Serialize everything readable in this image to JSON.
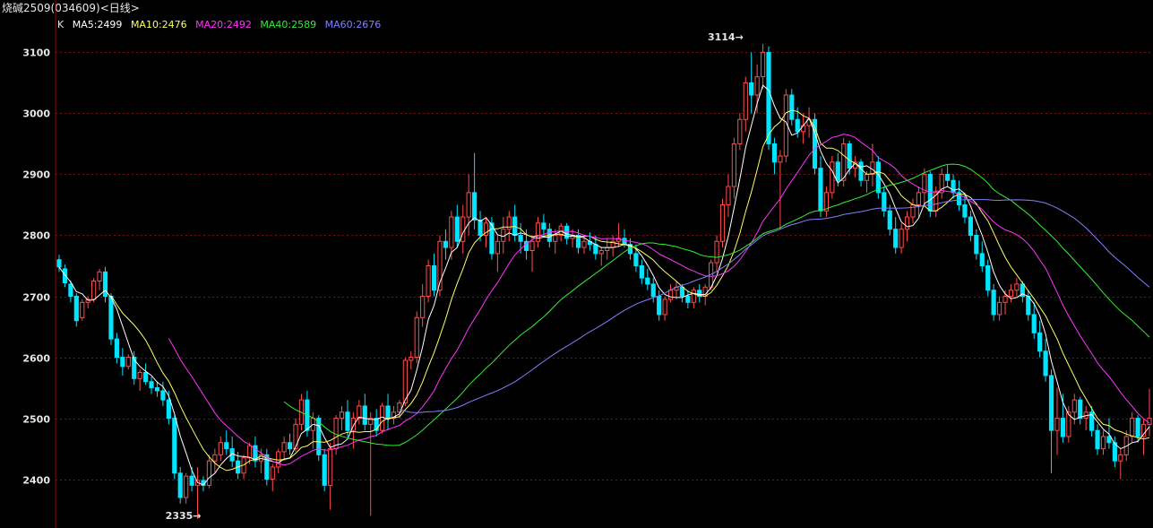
{
  "title": {
    "instrument": "烧碱2509",
    "code": "(034609)",
    "period": "<日线>"
  },
  "legend": {
    "k_label": "K",
    "items": [
      {
        "label": "MA5:2499",
        "color": "#ffffff"
      },
      {
        "label": "MA10:2476",
        "color": "#ffff66"
      },
      {
        "label": "MA20:2492",
        "color": "#ff33ff"
      },
      {
        "label": "MA40:2589",
        "color": "#33ee33"
      },
      {
        "label": "MA60:2676",
        "color": "#8080ff"
      }
    ]
  },
  "colors": {
    "up": "#ff4d4d",
    "down": "#00e5ff",
    "grid": "#7a1010",
    "axis": "#a00000"
  },
  "chart_data": {
    "type": "candlestick",
    "ylim": [
      2320,
      3130
    ],
    "yticks": [
      2400,
      2500,
      2600,
      2700,
      2800,
      2900,
      3000,
      3100
    ],
    "annotations": [
      {
        "text": "3114→",
        "index": 118,
        "value": 3114
      },
      {
        "text": "2335→",
        "index": 24,
        "value": 2335
      }
    ],
    "ohlc": [
      [
        2760,
        2768,
        2740,
        2748
      ],
      [
        2745,
        2752,
        2715,
        2722
      ],
      [
        2720,
        2726,
        2690,
        2700
      ],
      [
        2700,
        2705,
        2650,
        2660
      ],
      [
        2665,
        2695,
        2660,
        2690
      ],
      [
        2690,
        2700,
        2680,
        2695
      ],
      [
        2695,
        2730,
        2690,
        2725
      ],
      [
        2725,
        2745,
        2710,
        2740
      ],
      [
        2740,
        2748,
        2690,
        2700
      ],
      [
        2700,
        2705,
        2620,
        2630
      ],
      [
        2630,
        2640,
        2590,
        2600
      ],
      [
        2600,
        2615,
        2570,
        2585
      ],
      [
        2585,
        2605,
        2580,
        2600
      ],
      [
        2600,
        2610,
        2555,
        2565
      ],
      [
        2565,
        2580,
        2545,
        2575
      ],
      [
        2575,
        2590,
        2555,
        2560
      ],
      [
        2560,
        2568,
        2540,
        2550
      ],
      [
        2550,
        2560,
        2535,
        2545
      ],
      [
        2545,
        2560,
        2520,
        2530
      ],
      [
        2530,
        2545,
        2490,
        2500
      ],
      [
        2500,
        2505,
        2400,
        2410
      ],
      [
        2410,
        2420,
        2360,
        2370
      ],
      [
        2370,
        2410,
        2360,
        2405
      ],
      [
        2405,
        2420,
        2380,
        2390
      ],
      [
        2390,
        2420,
        2335,
        2398
      ],
      [
        2398,
        2405,
        2380,
        2390
      ],
      [
        2390,
        2440,
        2385,
        2430
      ],
      [
        2430,
        2450,
        2410,
        2440
      ],
      [
        2440,
        2470,
        2430,
        2460
      ],
      [
        2460,
        2480,
        2440,
        2450
      ],
      [
        2450,
        2470,
        2420,
        2430
      ],
      [
        2430,
        2445,
        2400,
        2410
      ],
      [
        2410,
        2440,
        2400,
        2435
      ],
      [
        2435,
        2460,
        2425,
        2455
      ],
      [
        2455,
        2470,
        2420,
        2430
      ],
      [
        2430,
        2450,
        2410,
        2440
      ],
      [
        2440,
        2450,
        2390,
        2400
      ],
      [
        2400,
        2425,
        2380,
        2420
      ],
      [
        2420,
        2450,
        2410,
        2445
      ],
      [
        2445,
        2470,
        2430,
        2460
      ],
      [
        2460,
        2475,
        2440,
        2450
      ],
      [
        2450,
        2500,
        2445,
        2490
      ],
      [
        2490,
        2540,
        2480,
        2530
      ],
      [
        2530,
        2545,
        2470,
        2480
      ],
      [
        2480,
        2510,
        2450,
        2500
      ],
      [
        2500,
        2505,
        2430,
        2440
      ],
      [
        2440,
        2450,
        2380,
        2390
      ],
      [
        2390,
        2460,
        2350,
        2450
      ],
      [
        2450,
        2505,
        2440,
        2500
      ],
      [
        2500,
        2520,
        2480,
        2510
      ],
      [
        2510,
        2530,
        2470,
        2480
      ],
      [
        2480,
        2510,
        2450,
        2500
      ],
      [
        2500,
        2530,
        2490,
        2520
      ],
      [
        2520,
        2540,
        2480,
        2490
      ],
      [
        2490,
        2510,
        2340,
        2500
      ],
      [
        2500,
        2515,
        2470,
        2480
      ],
      [
        2480,
        2525,
        2475,
        2520
      ],
      [
        2520,
        2540,
        2480,
        2500
      ],
      [
        2500,
        2520,
        2490,
        2510
      ],
      [
        2510,
        2530,
        2500,
        2525
      ],
      [
        2525,
        2600,
        2520,
        2595
      ],
      [
        2595,
        2610,
        2580,
        2600
      ],
      [
        2600,
        2675,
        2590,
        2665
      ],
      [
        2665,
        2720,
        2650,
        2700
      ],
      [
        2700,
        2760,
        2690,
        2750
      ],
      [
        2750,
        2770,
        2700,
        2710
      ],
      [
        2710,
        2800,
        2700,
        2790
      ],
      [
        2790,
        2810,
        2760,
        2780
      ],
      [
        2780,
        2840,
        2760,
        2830
      ],
      [
        2830,
        2850,
        2780,
        2790
      ],
      [
        2790,
        2850,
        2770,
        2830
      ],
      [
        2830,
        2900,
        2800,
        2870
      ],
      [
        2870,
        2935,
        2810,
        2825
      ],
      [
        2825,
        2840,
        2790,
        2800
      ],
      [
        2800,
        2830,
        2780,
        2820
      ],
      [
        2820,
        2830,
        2760,
        2770
      ],
      [
        2770,
        2800,
        2740,
        2790
      ],
      [
        2790,
        2830,
        2770,
        2810
      ],
      [
        2810,
        2840,
        2790,
        2830
      ],
      [
        2830,
        2850,
        2790,
        2800
      ],
      [
        2800,
        2820,
        2770,
        2790
      ],
      [
        2790,
        2810,
        2760,
        2775
      ],
      [
        2775,
        2800,
        2740,
        2790
      ],
      [
        2790,
        2830,
        2780,
        2820
      ],
      [
        2820,
        2835,
        2800,
        2810
      ],
      [
        2810,
        2820,
        2780,
        2790
      ],
      [
        2790,
        2810,
        2770,
        2800
      ],
      [
        2800,
        2820,
        2790,
        2815
      ],
      [
        2815,
        2820,
        2785,
        2795
      ],
      [
        2795,
        2810,
        2780,
        2800
      ],
      [
        2800,
        2810,
        2770,
        2780
      ],
      [
        2780,
        2800,
        2770,
        2790
      ],
      [
        2790,
        2805,
        2775,
        2785
      ],
      [
        2785,
        2800,
        2760,
        2770
      ],
      [
        2770,
        2780,
        2750,
        2775
      ],
      [
        2775,
        2795,
        2760,
        2780
      ],
      [
        2780,
        2800,
        2765,
        2790
      ],
      [
        2790,
        2820,
        2780,
        2795
      ],
      [
        2795,
        2810,
        2780,
        2785
      ],
      [
        2785,
        2795,
        2760,
        2770
      ],
      [
        2770,
        2785,
        2740,
        2750
      ],
      [
        2750,
        2760,
        2720,
        2730
      ],
      [
        2730,
        2745,
        2710,
        2720
      ],
      [
        2720,
        2730,
        2690,
        2700
      ],
      [
        2700,
        2710,
        2660,
        2670
      ],
      [
        2670,
        2700,
        2660,
        2695
      ],
      [
        2695,
        2720,
        2690,
        2710
      ],
      [
        2710,
        2725,
        2695,
        2715
      ],
      [
        2715,
        2720,
        2690,
        2700
      ],
      [
        2700,
        2710,
        2680,
        2690
      ],
      [
        2690,
        2715,
        2680,
        2710
      ],
      [
        2710,
        2720,
        2690,
        2700
      ],
      [
        2700,
        2720,
        2685,
        2715
      ],
      [
        2715,
        2760,
        2710,
        2755
      ],
      [
        2755,
        2800,
        2740,
        2790
      ],
      [
        2790,
        2860,
        2780,
        2850
      ],
      [
        2850,
        2900,
        2830,
        2880
      ],
      [
        2880,
        2960,
        2860,
        2950
      ],
      [
        2950,
        3000,
        2940,
        2990
      ],
      [
        2990,
        3060,
        2970,
        3050
      ],
      [
        3050,
        3100,
        3000,
        3030
      ],
      [
        3030,
        3080,
        3000,
        3060
      ],
      [
        3060,
        3114,
        3040,
        3100
      ],
      [
        3100,
        3110,
        2940,
        2950
      ],
      [
        2950,
        2960,
        2900,
        2920
      ],
      [
        2920,
        2940,
        2810,
        2930
      ],
      [
        2930,
        3040,
        2920,
        3030
      ],
      [
        3030,
        3040,
        2980,
        2990
      ],
      [
        2990,
        3010,
        2960,
        2970
      ],
      [
        2970,
        3000,
        2950,
        2980
      ],
      [
        2980,
        3010,
        2960,
        2990
      ],
      [
        2990,
        3000,
        2900,
        2910
      ],
      [
        2910,
        2930,
        2830,
        2840
      ],
      [
        2840,
        2880,
        2830,
        2870
      ],
      [
        2870,
        2930,
        2860,
        2920
      ],
      [
        2920,
        2935,
        2880,
        2890
      ],
      [
        2890,
        2960,
        2880,
        2950
      ],
      [
        2950,
        2955,
        2900,
        2910
      ],
      [
        2910,
        2930,
        2895,
        2920
      ],
      [
        2920,
        2925,
        2880,
        2890
      ],
      [
        2890,
        2905,
        2870,
        2900
      ],
      [
        2900,
        2950,
        2880,
        2920
      ],
      [
        2920,
        2930,
        2860,
        2870
      ],
      [
        2870,
        2880,
        2830,
        2840
      ],
      [
        2840,
        2850,
        2800,
        2810
      ],
      [
        2810,
        2830,
        2770,
        2780
      ],
      [
        2780,
        2820,
        2770,
        2810
      ],
      [
        2810,
        2840,
        2790,
        2830
      ],
      [
        2830,
        2860,
        2820,
        2850
      ],
      [
        2850,
        2880,
        2830,
        2870
      ],
      [
        2870,
        2910,
        2850,
        2900
      ],
      [
        2900,
        2905,
        2830,
        2840
      ],
      [
        2840,
        2880,
        2830,
        2870
      ],
      [
        2870,
        2910,
        2860,
        2900
      ],
      [
        2900,
        2915,
        2880,
        2890
      ],
      [
        2890,
        2900,
        2860,
        2870
      ],
      [
        2870,
        2890,
        2840,
        2850
      ],
      [
        2850,
        2870,
        2820,
        2830
      ],
      [
        2830,
        2840,
        2790,
        2800
      ],
      [
        2800,
        2810,
        2760,
        2770
      ],
      [
        2770,
        2790,
        2740,
        2750
      ],
      [
        2750,
        2760,
        2700,
        2710
      ],
      [
        2710,
        2720,
        2660,
        2670
      ],
      [
        2670,
        2700,
        2660,
        2690
      ],
      [
        2690,
        2710,
        2670,
        2700
      ],
      [
        2700,
        2720,
        2690,
        2710
      ],
      [
        2710,
        2730,
        2700,
        2720
      ],
      [
        2720,
        2725,
        2690,
        2700
      ],
      [
        2700,
        2710,
        2660,
        2670
      ],
      [
        2670,
        2690,
        2630,
        2640
      ],
      [
        2640,
        2660,
        2600,
        2610
      ],
      [
        2610,
        2630,
        2560,
        2570
      ],
      [
        2570,
        2580,
        2410,
        2480
      ],
      [
        2480,
        2550,
        2440,
        2500
      ],
      [
        2500,
        2540,
        2460,
        2470
      ],
      [
        2470,
        2520,
        2460,
        2510
      ],
      [
        2510,
        2540,
        2490,
        2530
      ],
      [
        2530,
        2535,
        2490,
        2500
      ],
      [
        2500,
        2520,
        2480,
        2510
      ],
      [
        2510,
        2520,
        2470,
        2480
      ],
      [
        2480,
        2490,
        2440,
        2450
      ],
      [
        2450,
        2480,
        2440,
        2470
      ],
      [
        2470,
        2500,
        2450,
        2460
      ],
      [
        2460,
        2470,
        2420,
        2430
      ],
      [
        2430,
        2450,
        2400,
        2440
      ],
      [
        2440,
        2480,
        2430,
        2470
      ],
      [
        2470,
        2510,
        2460,
        2500
      ],
      [
        2500,
        2505,
        2460,
        2470
      ],
      [
        2470,
        2500,
        2440,
        2490
      ],
      [
        2490,
        2548,
        2470,
        2500
      ]
    ],
    "series": [
      {
        "name": "MA5",
        "period": 5,
        "start": 0,
        "color": "#ffffff"
      },
      {
        "name": "MA10",
        "period": 10,
        "start": 9,
        "color": "#ffff66"
      },
      {
        "name": "MA20",
        "period": 20,
        "start": 19,
        "color": "#ff33ff"
      },
      {
        "name": "MA40",
        "period": 40,
        "start": 39,
        "color": "#33ee33"
      },
      {
        "name": "MA60",
        "period": 60,
        "start": 59,
        "color": "#8080ff"
      }
    ]
  }
}
